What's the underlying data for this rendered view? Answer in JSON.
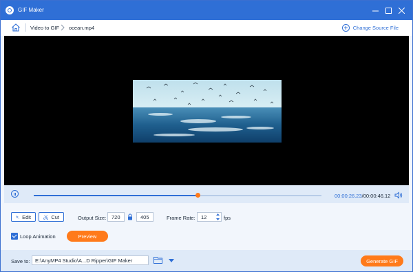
{
  "window": {
    "title": "GIF Maker"
  },
  "breadcrumb": {
    "items": [
      "Video to GIF",
      "ocean.mp4"
    ]
  },
  "change_source_label": "Change Source File",
  "playback": {
    "current_time": "00:00:26.23",
    "separator": "/",
    "duration": "00:00:46.12",
    "progress": 0.57
  },
  "tools": {
    "edit_label": "Edit",
    "cut_label": "Cut"
  },
  "output_size": {
    "label": "Output Size:",
    "width": "720",
    "height": "405"
  },
  "frame_rate": {
    "label": "Frame Rate:",
    "value": "12",
    "unit": "fps"
  },
  "loop_animation": {
    "label": "Loop Animation",
    "checked": true
  },
  "preview_label": "Preview",
  "save": {
    "label": "Save to:",
    "path": "E:\\AnyMP4 Studio\\A...D Ripper\\GIF Maker"
  },
  "generate_label": "Generate GIF",
  "colors": {
    "accent": "#2f6fd6",
    "orange": "#ff7a1a",
    "panel": "#dfeaf8"
  },
  "icons": [
    "app-logo-icon",
    "minimize-icon",
    "maximize-icon",
    "close-icon",
    "home-icon",
    "chevron-right-icon",
    "plus-circle-icon",
    "pause-icon",
    "volume-icon",
    "edit-star-icon",
    "scissors-icon",
    "lock-icon",
    "spinner-icon",
    "checkbox-icon",
    "dropdown-arrow-icon",
    "folder-icon"
  ]
}
